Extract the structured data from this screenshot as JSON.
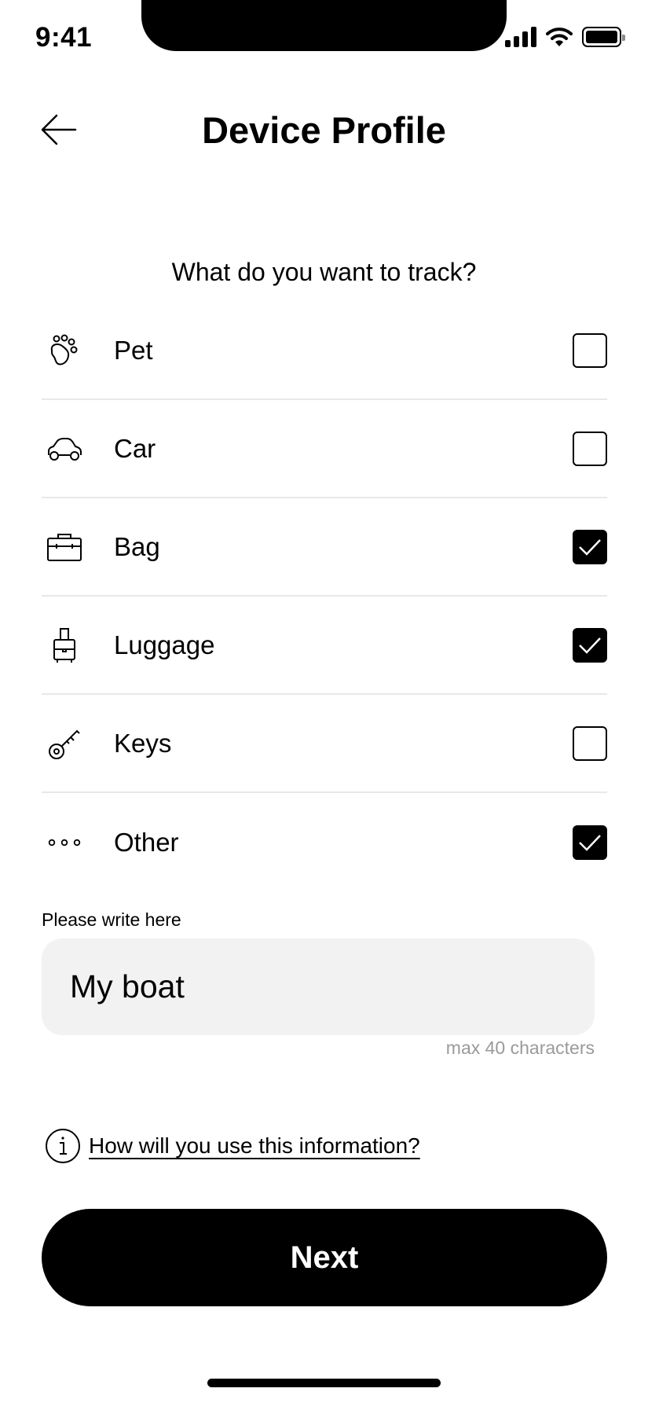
{
  "status_bar": {
    "time": "9:41"
  },
  "header": {
    "title": "Device Profile",
    "back_icon": "arrow-left-icon"
  },
  "question": "What do you want to track?",
  "options": [
    {
      "label": "Pet",
      "icon": "paw-icon",
      "checked": false
    },
    {
      "label": "Car",
      "icon": "car-icon",
      "checked": false
    },
    {
      "label": "Bag",
      "icon": "briefcase-icon",
      "checked": true
    },
    {
      "label": "Luggage",
      "icon": "luggage-icon",
      "checked": true
    },
    {
      "label": "Keys",
      "icon": "key-icon",
      "checked": false
    },
    {
      "label": "Other",
      "icon": "more-dots-icon",
      "checked": true
    }
  ],
  "other_field": {
    "label": "Please write here",
    "value": "My boat",
    "hint": "max 40 characters"
  },
  "info_link": {
    "label": "How will you use this information?",
    "icon": "info-icon"
  },
  "next_button": {
    "label": "Next"
  },
  "colors": {
    "primary": "#000000",
    "field_bg": "#f2f2f2",
    "divider": "#e8e8e8",
    "hint_text": "#9a9a9a"
  }
}
